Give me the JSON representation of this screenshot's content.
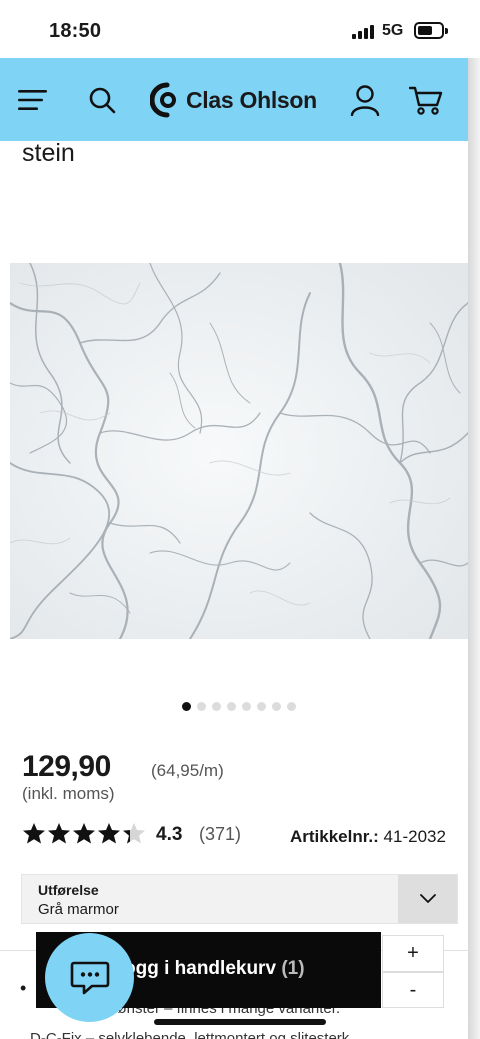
{
  "status_bar": {
    "time": "18:50",
    "network": "5G"
  },
  "header": {
    "brand": "Clas Ohlson",
    "icons": [
      "menu-icon",
      "search-icon",
      "account-icon",
      "cart-icon"
    ],
    "bg_color": "#7fd3f5"
  },
  "product": {
    "title_fragment": "stein",
    "image_alt": "Grå marmor",
    "gallery": {
      "count": 8,
      "active_index": 0
    },
    "price": "129,90",
    "unit_price": "(64,95/m)",
    "vat_note": "(inkl. moms)",
    "rating": {
      "value": "4.3",
      "count": "(371)",
      "stars_filled": 4.3,
      "stars_max": 5
    },
    "article_label": "Artikkelnr.:",
    "article_number": "41-2032",
    "variant": {
      "label": "Utførelse",
      "value": "Grå marmor"
    }
  },
  "description": {
    "bullet": "•",
    "line1": "mønster – finnes i mange varianter.",
    "line2": "D-C-Fix – selvklebende, lettmontert og slitesterk"
  },
  "cart_bar": {
    "label": "ogg i handlekurv",
    "count": "(1)",
    "plus": "+",
    "minus": "-"
  },
  "colors": {
    "accent": "#7fd3f5",
    "cart_bar": "#0a0a0a"
  }
}
